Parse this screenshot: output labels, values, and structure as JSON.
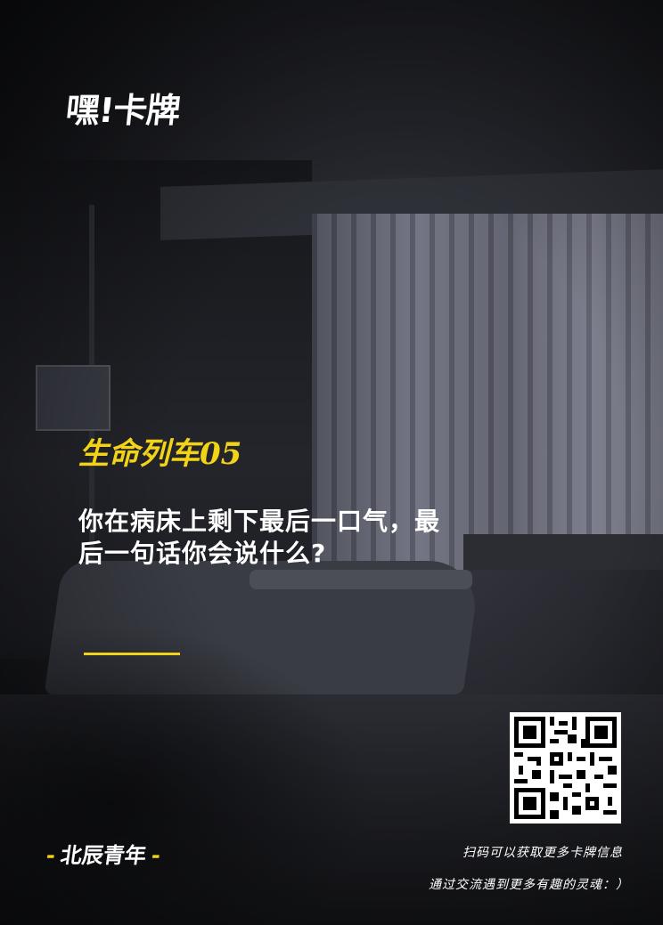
{
  "logo": {
    "text": "嘿!卡牌"
  },
  "title": "生命列车05",
  "question": "你在病床上剩下最后一口气，最后一句话你会说什么?",
  "brand": {
    "dash_left": "-",
    "name": "北辰青年",
    "dash_right": "-"
  },
  "info": {
    "line1": "扫码可以获取更多卡牌信息",
    "line2": "通过交流遇到更多有趣的灵魂：）"
  },
  "colors": {
    "accent": "#f2d318",
    "text": "#ffffff",
    "background": "#1a1b1f"
  },
  "icons": {
    "qr": "qr-code-icon"
  }
}
